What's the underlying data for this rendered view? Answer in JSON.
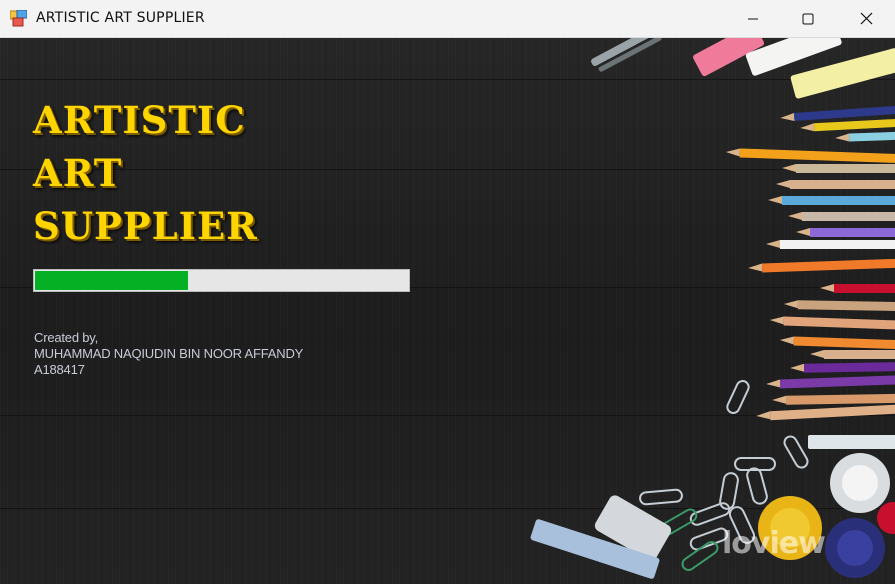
{
  "window": {
    "title": "ARTISTIC ART SUPPLIER",
    "icon": "app-window-icon",
    "controls": [
      "minimize-icon",
      "maximize-icon",
      "close-icon"
    ]
  },
  "splash": {
    "headline": [
      "ARTISTIC",
      "ART",
      "SUPPLIER"
    ],
    "headline_color": "#ffd500",
    "progress": {
      "fraction": 0.41,
      "fill_color": "#06b025",
      "track_color": "#e6e6e6"
    },
    "credits": [
      "Created by,",
      "MUHAMMAD NAQIUDIN BIN NOOR AFFANDY",
      "A188417"
    ]
  },
  "background": {
    "description_icons": [
      "colored-pencils",
      "chalk-sticks",
      "paper-clips",
      "paint-pots",
      "eraser"
    ],
    "watermark": "loview"
  }
}
